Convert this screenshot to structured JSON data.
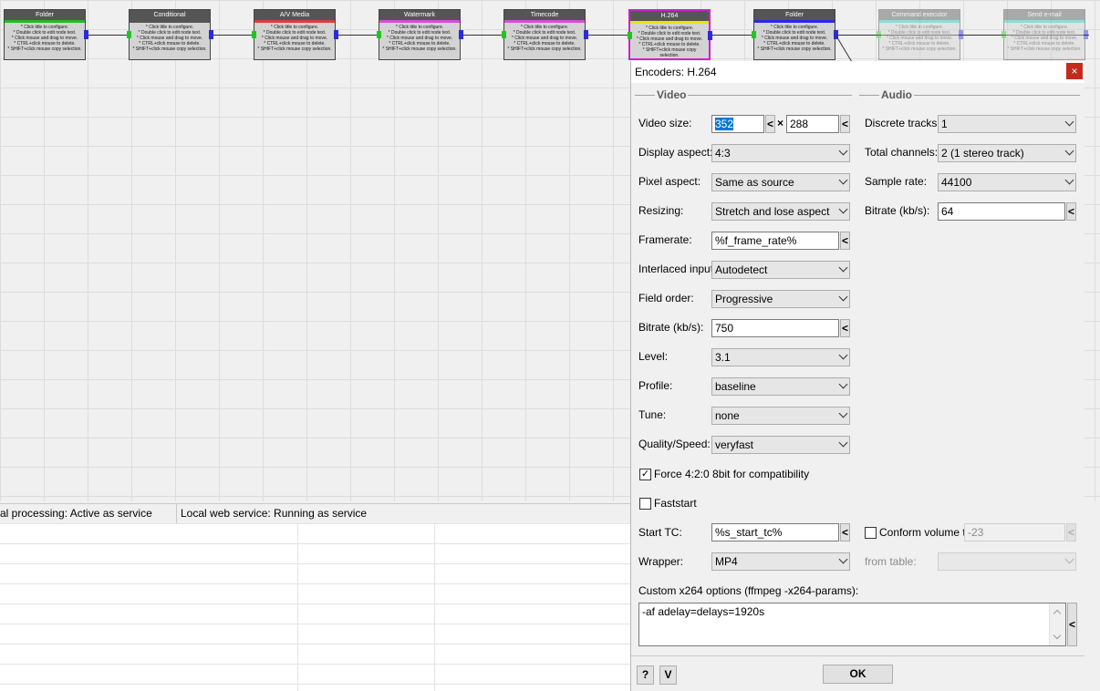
{
  "workflow": {
    "help_text": "* Click title to configure.\n* Double click to edit node text.\n* Click mouse and drag to move.\n* CTRL+click mouse to delete.\n* SHIFT+click mouse copy selection.",
    "nodes": [
      {
        "title": "Folder",
        "accent": "#22bb22",
        "state": "normal"
      },
      {
        "title": "Conditional",
        "accent": "#555555",
        "state": "normal"
      },
      {
        "title": "A/V Media",
        "accent": "#e03c3c",
        "state": "normal"
      },
      {
        "title": "Watermark",
        "accent": "#d64fd6",
        "state": "normal"
      },
      {
        "title": "Timecode",
        "accent": "#d64fd6",
        "state": "normal"
      },
      {
        "title": "H.264",
        "accent": "#e6e600",
        "state": "selected"
      },
      {
        "title": "Folder",
        "accent": "#2a2ae6",
        "state": "normal"
      },
      {
        "title": "Command executor",
        "accent": "#21c0c0",
        "state": "disabled"
      },
      {
        "title": "Send e-mail",
        "accent": "#21c0c0",
        "state": "disabled"
      }
    ]
  },
  "statusbar": {
    "processing": "al processing: Active as service",
    "web_service": "Local web service: Running as service"
  },
  "dialog": {
    "title": "Encoders: H.264",
    "close_glyph": "×",
    "video_section": "Video",
    "audio_section": "Audio",
    "video": {
      "video_size_label": "Video size:",
      "width": "352",
      "times": "×",
      "height": "288",
      "display_aspect_label": "Display aspect:",
      "display_aspect": "4:3",
      "pixel_aspect_label": "Pixel aspect:",
      "pixel_aspect": "Same as source",
      "resizing_label": "Resizing:",
      "resizing": "Stretch and lose aspect",
      "framerate_label": "Framerate:",
      "framerate": "%f_frame_rate%",
      "interlaced_label": "Interlaced input:",
      "interlaced": "Autodetect",
      "field_order_label": "Field order:",
      "field_order": "Progressive",
      "bitrate_label": "Bitrate (kb/s):",
      "bitrate": "750",
      "level_label": "Level:",
      "level": "3.1",
      "profile_label": "Profile:",
      "profile": "baseline",
      "tune_label": "Tune:",
      "tune": "none",
      "quality_label": "Quality/Speed:",
      "quality": "veryfast",
      "force_420_label": "Force 4:2:0 8bit for compatibility",
      "force_420_checked": "✓",
      "faststart_label": "Faststart",
      "start_tc_label": "Start TC:",
      "start_tc": "%s_start_tc%",
      "wrapper_label": "Wrapper:",
      "wrapper": "MP4"
    },
    "audio": {
      "discrete_tracks_label": "Discrete tracks:",
      "discrete_tracks": "1",
      "total_channels_label": "Total channels:",
      "total_channels": "2 (1 stereo track)",
      "sample_rate_label": "Sample rate:",
      "sample_rate": "44100",
      "bitrate_label": "Bitrate (kb/s):",
      "bitrate": "64",
      "conform_label": "Conform volume to",
      "conform_value": "-23",
      "from_table_label": "from table:",
      "from_table": ""
    },
    "custom_options_label": "Custom x264 options (ffmpeg -x264-params):",
    "custom_options": "-af adelay=delays=1920s",
    "insert_glyph": "<",
    "help_button": "?",
    "v_button": "V",
    "ok_button": "OK"
  }
}
